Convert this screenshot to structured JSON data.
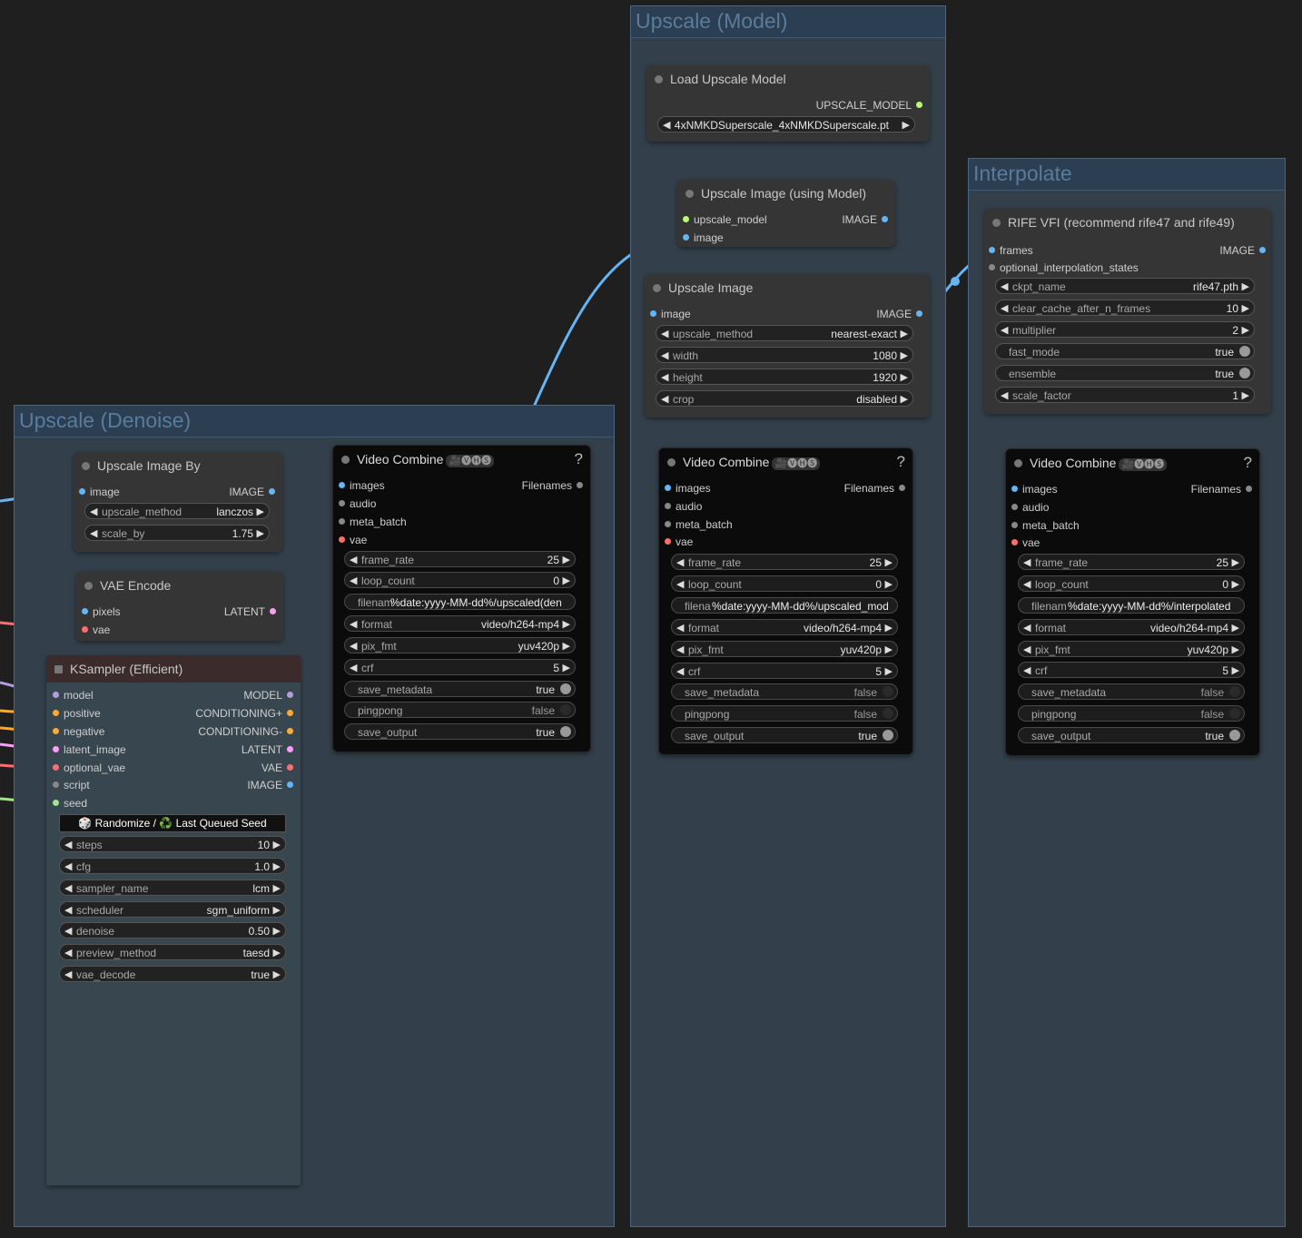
{
  "groups": {
    "upscale_model": "Upscale (Model)",
    "interpolate": "Interpolate",
    "upscale_denoise": "Upscale (Denoise)"
  },
  "load_upscale_model": {
    "title": "Load Upscale Model",
    "out": "UPSCALE_MODEL",
    "model_name": "4xNMKDSuperscale_4xNMKDSuperscale.pt"
  },
  "upscale_using_model": {
    "title": "Upscale Image (using Model)",
    "in_model": "upscale_model",
    "in_image": "image",
    "out": "IMAGE"
  },
  "upscale_image": {
    "title": "Upscale Image",
    "in_image": "image",
    "out": "IMAGE",
    "widgets": [
      {
        "label": "upscale_method",
        "value": "nearest-exact"
      },
      {
        "label": "width",
        "value": "1080"
      },
      {
        "label": "height",
        "value": "1920"
      },
      {
        "label": "crop",
        "value": "disabled"
      }
    ]
  },
  "rife": {
    "title": "RIFE VFI (recommend rife47 and rife49)",
    "in_frames": "frames",
    "in_states": "optional_interpolation_states",
    "out": "IMAGE",
    "widgets": [
      {
        "label": "ckpt_name",
        "value": "rife47.pth"
      },
      {
        "label": "clear_cache_after_n_frames",
        "value": "10"
      },
      {
        "label": "multiplier",
        "value": "2"
      }
    ],
    "toggles": [
      {
        "label": "fast_mode",
        "value": "true"
      },
      {
        "label": "ensemble",
        "value": "true"
      }
    ],
    "scale_factor": {
      "label": "scale_factor",
      "value": "1"
    }
  },
  "upscale_by": {
    "title": "Upscale Image By",
    "in_image": "image",
    "out": "IMAGE",
    "widgets": [
      {
        "label": "upscale_method",
        "value": "lanczos"
      },
      {
        "label": "scale_by",
        "value": "1.75"
      }
    ]
  },
  "vae_encode": {
    "title": "VAE Encode",
    "in_pixels": "pixels",
    "in_vae": "vae",
    "out": "LATENT"
  },
  "ksampler": {
    "title": "KSampler (Efficient)",
    "inputs": [
      "model",
      "positive",
      "negative",
      "latent_image",
      "optional_vae",
      "script",
      "seed"
    ],
    "outputs": [
      "MODEL",
      "CONDITIONING+",
      "CONDITIONING-",
      "LATENT",
      "VAE",
      "IMAGE"
    ],
    "seed_button": "🎲 Randomize / ♻️ Last Queued Seed",
    "widgets": [
      {
        "label": "steps",
        "value": "10"
      },
      {
        "label": "cfg",
        "value": "1.0"
      },
      {
        "label": "sampler_name",
        "value": "lcm"
      },
      {
        "label": "scheduler",
        "value": "sgm_uniform"
      },
      {
        "label": "denoise",
        "value": "0.50"
      },
      {
        "label": "preview_method",
        "value": "taesd"
      },
      {
        "label": "vae_decode",
        "value": "true"
      }
    ]
  },
  "video_combine_label": "Video Combine",
  "vhs_badge": "🎥🅥🅗🅢",
  "help": "?",
  "vc_inputs": [
    "images",
    "audio",
    "meta_batch",
    "vae"
  ],
  "vc_output": "Filenames",
  "vc_common": {
    "frame_rate": {
      "label": "frame_rate",
      "value": "25"
    },
    "loop_count": {
      "label": "loop_count",
      "value": "0"
    },
    "format": {
      "label": "format",
      "value": "video/h264-mp4"
    },
    "pix_fmt": {
      "label": "pix_fmt",
      "value": "yuv420p"
    },
    "crf": {
      "label": "crf",
      "value": "5"
    },
    "pingpong": {
      "label": "pingpong",
      "value": "false"
    },
    "save_output": {
      "label": "save_output",
      "value": "true"
    }
  },
  "vc1": {
    "prefix_label": "filenam",
    "prefix": "%date:yyyy-MM-dd%/upscaled(den",
    "save_metadata": "true"
  },
  "vc2": {
    "prefix_label": "filena",
    "prefix": "%date:yyyy-MM-dd%/upscaled_mod",
    "save_metadata": "false"
  },
  "vc3": {
    "prefix_label": "filenam",
    "prefix": "%date:yyyy-MM-dd%/interpolated",
    "save_metadata": "false"
  },
  "save_metadata_label": "save_metadata",
  "colors": {
    "image": "#64b5f6",
    "latent": "#ff9cf9",
    "vae": "#ff6e6e",
    "model": "#b39ddb",
    "conditioning": "#ffa931",
    "upscale_model": "#b7ff6f",
    "script": "#888888",
    "int": "#a5e38c"
  }
}
